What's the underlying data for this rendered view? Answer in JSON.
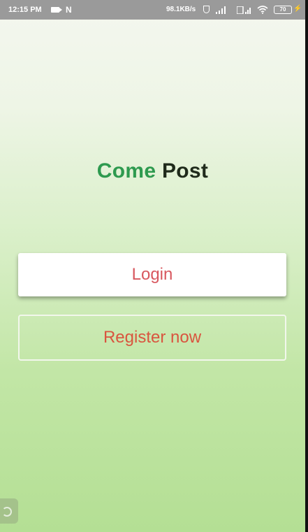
{
  "status_bar": {
    "time": "12:15 PM",
    "notification_letter": "N",
    "network_speed": "98.1KB/s",
    "battery_level": "70",
    "icons": [
      "video-camera-icon",
      "shield-icon",
      "signal-icon",
      "signal-icon",
      "wifi-icon",
      "battery-icon",
      "charging-bolt-icon"
    ]
  },
  "app": {
    "title_part1": "Come",
    "title_part2": "Post"
  },
  "buttons": {
    "login_label": "Login",
    "register_label": "Register now"
  },
  "colors": {
    "title_green": "#2e9a4f",
    "title_dark": "#1f2a1b",
    "login_text": "#d8585f",
    "register_text": "#d9553f",
    "background_top": "#f4f7ef",
    "background_bottom": "#b4df94"
  }
}
